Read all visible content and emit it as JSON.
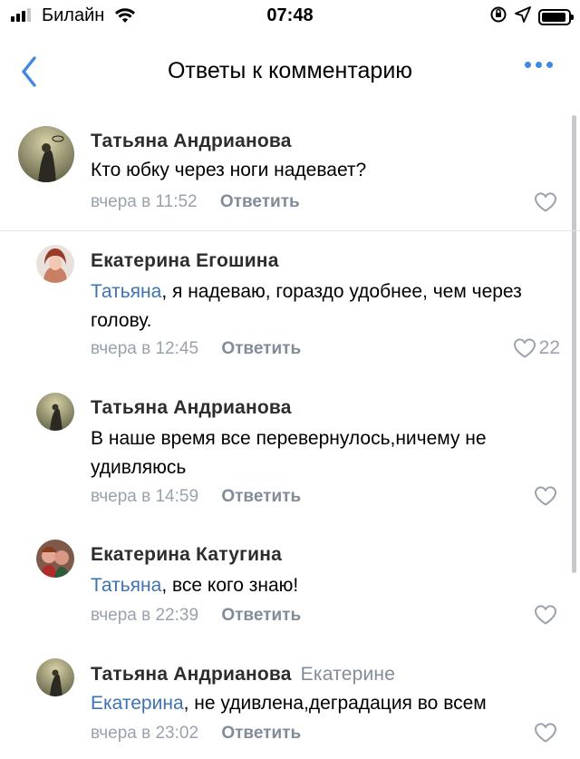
{
  "status_bar": {
    "carrier": "Билайн",
    "time": "07:48"
  },
  "nav": {
    "title": "Ответы к комментарию",
    "back_icon": "chevron-left-icon",
    "more_icon": "more-dots-icon"
  },
  "colors": {
    "accent": "#3f8ae0",
    "mention": "#3f73b0",
    "secondary": "#99a2ad"
  },
  "comments": [
    {
      "author": "Татьяна Андрианова",
      "reply_to": "",
      "mention": "",
      "text": "Кто юбку через ноги надевает?",
      "time": "вчера в 11:52",
      "reply_label": "Ответить",
      "likes": ""
    },
    {
      "author": "Екатерина Егошина",
      "reply_to": "",
      "mention": "Татьяна",
      "text": ", я надеваю, гораздо удобнее, чем через голову.",
      "time": "вчера в 12:45",
      "reply_label": "Ответить",
      "likes": "22"
    },
    {
      "author": "Татьяна Андрианова",
      "reply_to": "",
      "mention": "",
      "text": "В наше время все перевернулось,ничему не удивляюсь",
      "time": "вчера в 14:59",
      "reply_label": "Ответить",
      "likes": ""
    },
    {
      "author": "Екатерина Катугина",
      "reply_to": "",
      "mention": "Татьяна",
      "text": ", все кого знаю!",
      "time": "вчера в 22:39",
      "reply_label": "Ответить",
      "likes": ""
    },
    {
      "author": "Татьяна Андрианова",
      "reply_to": "Екатерине",
      "mention": "Екатерина",
      "text": ", не удивлена,деградация во всем",
      "time": "вчера в 23:02",
      "reply_label": "Ответить",
      "likes": ""
    }
  ]
}
